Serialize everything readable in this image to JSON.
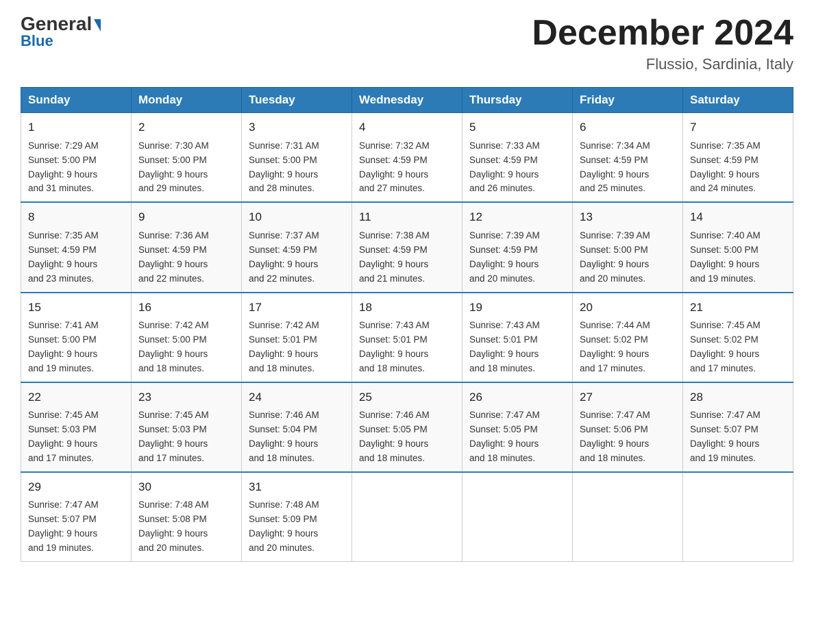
{
  "logo": {
    "part1": "General",
    "part2": "Blue"
  },
  "header": {
    "title": "December 2024",
    "location": "Flussio, Sardinia, Italy"
  },
  "days_of_week": [
    "Sunday",
    "Monday",
    "Tuesday",
    "Wednesday",
    "Thursday",
    "Friday",
    "Saturday"
  ],
  "weeks": [
    [
      {
        "day": "1",
        "info": "Sunrise: 7:29 AM\nSunset: 5:00 PM\nDaylight: 9 hours\nand 31 minutes."
      },
      {
        "day": "2",
        "info": "Sunrise: 7:30 AM\nSunset: 5:00 PM\nDaylight: 9 hours\nand 29 minutes."
      },
      {
        "day": "3",
        "info": "Sunrise: 7:31 AM\nSunset: 5:00 PM\nDaylight: 9 hours\nand 28 minutes."
      },
      {
        "day": "4",
        "info": "Sunrise: 7:32 AM\nSunset: 4:59 PM\nDaylight: 9 hours\nand 27 minutes."
      },
      {
        "day": "5",
        "info": "Sunrise: 7:33 AM\nSunset: 4:59 PM\nDaylight: 9 hours\nand 26 minutes."
      },
      {
        "day": "6",
        "info": "Sunrise: 7:34 AM\nSunset: 4:59 PM\nDaylight: 9 hours\nand 25 minutes."
      },
      {
        "day": "7",
        "info": "Sunrise: 7:35 AM\nSunset: 4:59 PM\nDaylight: 9 hours\nand 24 minutes."
      }
    ],
    [
      {
        "day": "8",
        "info": "Sunrise: 7:35 AM\nSunset: 4:59 PM\nDaylight: 9 hours\nand 23 minutes."
      },
      {
        "day": "9",
        "info": "Sunrise: 7:36 AM\nSunset: 4:59 PM\nDaylight: 9 hours\nand 22 minutes."
      },
      {
        "day": "10",
        "info": "Sunrise: 7:37 AM\nSunset: 4:59 PM\nDaylight: 9 hours\nand 22 minutes."
      },
      {
        "day": "11",
        "info": "Sunrise: 7:38 AM\nSunset: 4:59 PM\nDaylight: 9 hours\nand 21 minutes."
      },
      {
        "day": "12",
        "info": "Sunrise: 7:39 AM\nSunset: 4:59 PM\nDaylight: 9 hours\nand 20 minutes."
      },
      {
        "day": "13",
        "info": "Sunrise: 7:39 AM\nSunset: 5:00 PM\nDaylight: 9 hours\nand 20 minutes."
      },
      {
        "day": "14",
        "info": "Sunrise: 7:40 AM\nSunset: 5:00 PM\nDaylight: 9 hours\nand 19 minutes."
      }
    ],
    [
      {
        "day": "15",
        "info": "Sunrise: 7:41 AM\nSunset: 5:00 PM\nDaylight: 9 hours\nand 19 minutes."
      },
      {
        "day": "16",
        "info": "Sunrise: 7:42 AM\nSunset: 5:00 PM\nDaylight: 9 hours\nand 18 minutes."
      },
      {
        "day": "17",
        "info": "Sunrise: 7:42 AM\nSunset: 5:01 PM\nDaylight: 9 hours\nand 18 minutes."
      },
      {
        "day": "18",
        "info": "Sunrise: 7:43 AM\nSunset: 5:01 PM\nDaylight: 9 hours\nand 18 minutes."
      },
      {
        "day": "19",
        "info": "Sunrise: 7:43 AM\nSunset: 5:01 PM\nDaylight: 9 hours\nand 18 minutes."
      },
      {
        "day": "20",
        "info": "Sunrise: 7:44 AM\nSunset: 5:02 PM\nDaylight: 9 hours\nand 17 minutes."
      },
      {
        "day": "21",
        "info": "Sunrise: 7:45 AM\nSunset: 5:02 PM\nDaylight: 9 hours\nand 17 minutes."
      }
    ],
    [
      {
        "day": "22",
        "info": "Sunrise: 7:45 AM\nSunset: 5:03 PM\nDaylight: 9 hours\nand 17 minutes."
      },
      {
        "day": "23",
        "info": "Sunrise: 7:45 AM\nSunset: 5:03 PM\nDaylight: 9 hours\nand 17 minutes."
      },
      {
        "day": "24",
        "info": "Sunrise: 7:46 AM\nSunset: 5:04 PM\nDaylight: 9 hours\nand 18 minutes."
      },
      {
        "day": "25",
        "info": "Sunrise: 7:46 AM\nSunset: 5:05 PM\nDaylight: 9 hours\nand 18 minutes."
      },
      {
        "day": "26",
        "info": "Sunrise: 7:47 AM\nSunset: 5:05 PM\nDaylight: 9 hours\nand 18 minutes."
      },
      {
        "day": "27",
        "info": "Sunrise: 7:47 AM\nSunset: 5:06 PM\nDaylight: 9 hours\nand 18 minutes."
      },
      {
        "day": "28",
        "info": "Sunrise: 7:47 AM\nSunset: 5:07 PM\nDaylight: 9 hours\nand 19 minutes."
      }
    ],
    [
      {
        "day": "29",
        "info": "Sunrise: 7:47 AM\nSunset: 5:07 PM\nDaylight: 9 hours\nand 19 minutes."
      },
      {
        "day": "30",
        "info": "Sunrise: 7:48 AM\nSunset: 5:08 PM\nDaylight: 9 hours\nand 20 minutes."
      },
      {
        "day": "31",
        "info": "Sunrise: 7:48 AM\nSunset: 5:09 PM\nDaylight: 9 hours\nand 20 minutes."
      },
      {
        "day": "",
        "info": ""
      },
      {
        "day": "",
        "info": ""
      },
      {
        "day": "",
        "info": ""
      },
      {
        "day": "",
        "info": ""
      }
    ]
  ]
}
